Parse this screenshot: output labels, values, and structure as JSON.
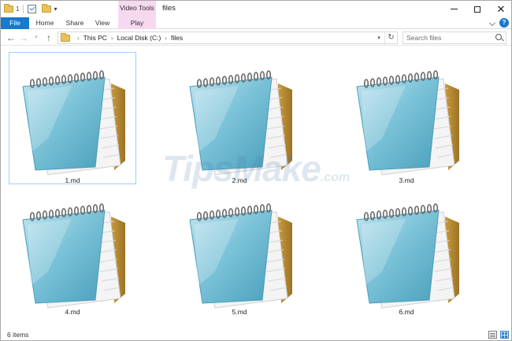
{
  "window": {
    "title": "files",
    "contextual_group": "Video Tools",
    "qat_number": "1"
  },
  "ribbon": {
    "tabs": [
      {
        "label": "File",
        "kind": "file"
      },
      {
        "label": "Home",
        "kind": "normal"
      },
      {
        "label": "Share",
        "kind": "normal"
      },
      {
        "label": "View",
        "kind": "normal"
      },
      {
        "label": "Play",
        "kind": "contextual"
      }
    ]
  },
  "address": {
    "breadcrumbs": [
      "This PC",
      "Local Disk (C:)",
      "files"
    ]
  },
  "search": {
    "placeholder": "Search files"
  },
  "files": [
    {
      "name": "1.md",
      "selected": true
    },
    {
      "name": "2.md",
      "selected": false
    },
    {
      "name": "3.md",
      "selected": false
    },
    {
      "name": "4.md",
      "selected": false
    },
    {
      "name": "5.md",
      "selected": false
    },
    {
      "name": "6.md",
      "selected": false
    }
  ],
  "file_icon": "notepad-icon",
  "watermark": {
    "main": "TipsMake",
    "suffix": ".com"
  },
  "status": {
    "item_count": "6 items"
  },
  "colors": {
    "file_tab": "#1979ca",
    "contextual": "#f6d8ef",
    "selection_border": "#99d1ff"
  }
}
